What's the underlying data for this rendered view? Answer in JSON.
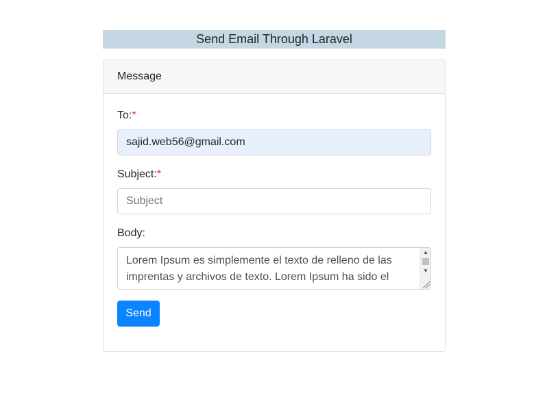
{
  "page": {
    "title": "Send Email Through Laravel"
  },
  "card": {
    "header": "Message"
  },
  "form": {
    "to": {
      "label": "To:",
      "required_mark": "*",
      "value": "sajid.web56@gmail.com"
    },
    "subject": {
      "label": "Subject:",
      "required_mark": "*",
      "value": "",
      "placeholder": "Subject"
    },
    "body": {
      "label": "Body:",
      "value": "Lorem Ipsum es simplemente el texto de relleno de las imprentas y archivos de texto. Lorem Ipsum ha sido el"
    },
    "send_label": "Send"
  },
  "colors": {
    "title_bar": "#c4d7e2",
    "required": "#e3342f",
    "primary_button": "#0a84ff",
    "autofill_background": "#e8f0fe"
  },
  "icons": {
    "scroll_up": "scroll-up-arrow-icon",
    "scroll_down": "scroll-down-arrow-icon",
    "resize": "resize-grip-icon"
  }
}
